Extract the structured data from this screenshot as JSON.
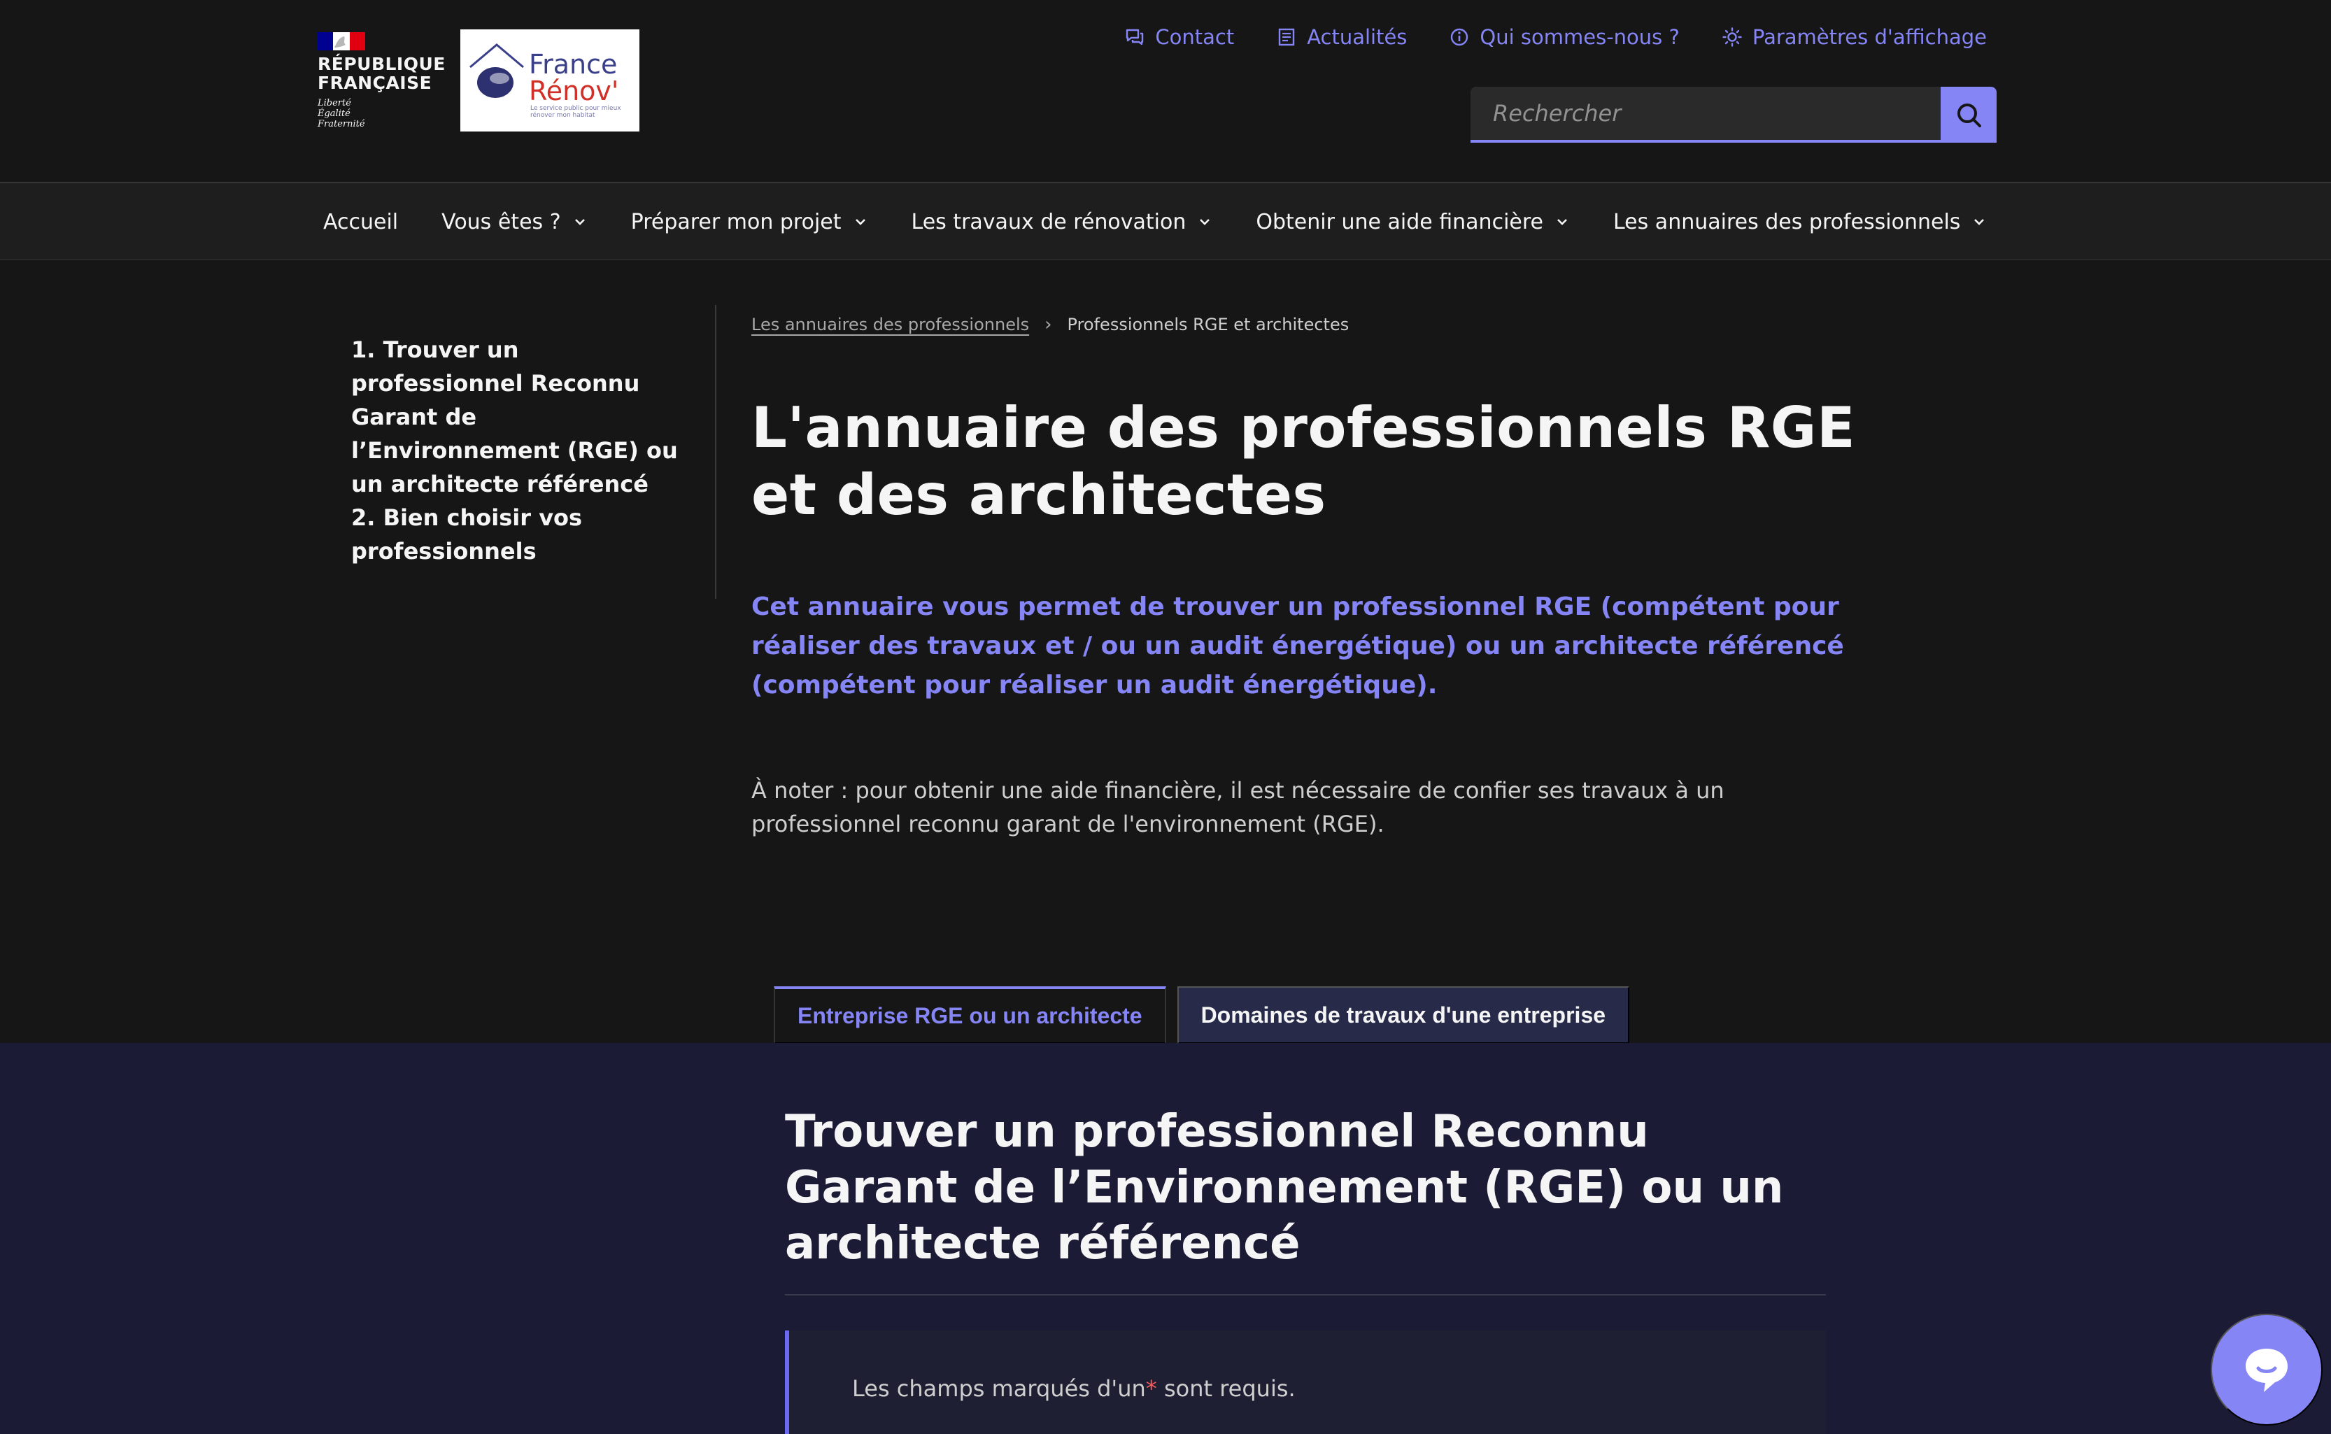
{
  "header": {
    "marianne": {
      "republic": "RÉPUBLIQUE\nFRANÇAISE",
      "motto": "Liberté\nÉgalité\nFraternité"
    },
    "operator": {
      "line1": "France",
      "line2": "Rénov'",
      "tagline": "Le service public pour mieux rénover mon habitat"
    },
    "quick_access": [
      {
        "label": "Contact",
        "icon": "chat-icon"
      },
      {
        "label": "Actualités",
        "icon": "newspaper-icon"
      },
      {
        "label": "Qui sommes-nous ?",
        "icon": "info-icon"
      },
      {
        "label": "Paramètres d'affichage",
        "icon": "sun-icon"
      }
    ],
    "search": {
      "placeholder": "Rechercher",
      "icon": "search-icon"
    }
  },
  "nav": {
    "items": [
      {
        "label": "Accueil",
        "has_dropdown": false
      },
      {
        "label": "Vous êtes ?",
        "has_dropdown": true
      },
      {
        "label": "Préparer mon projet",
        "has_dropdown": true
      },
      {
        "label": "Les travaux de rénovation",
        "has_dropdown": true
      },
      {
        "label": "Obtenir une aide financière",
        "has_dropdown": true
      },
      {
        "label": "Les annuaires des professionnels",
        "has_dropdown": true
      }
    ]
  },
  "sidemenu": {
    "items": [
      {
        "label": "1. Trouver un professionnel Reconnu Garant de l’Environnement (RGE) ou un architecte référencé"
      },
      {
        "label": "2. Bien choisir vos professionnels"
      }
    ]
  },
  "breadcrumb": {
    "items": [
      {
        "label": "Les annuaires des professionnels"
      },
      {
        "label": "Professionnels RGE et architectes"
      }
    ],
    "separator": "›"
  },
  "content": {
    "title": "L'annuaire des professionnels RGE et des architectes",
    "lead": "Cet annuaire vous permet de trouver un professionnel RGE (compétent pour réaliser des travaux et / ou un audit énergétique) ou un architecte référencé (compétent pour réaliser un audit énergétique).",
    "note": "À noter : pour obtenir une aide financière, il est nécessaire de confier ses travaux à un professionnel reconnu garant de l'environnement (RGE)."
  },
  "tabs": {
    "items": [
      {
        "label": "Entreprise RGE ou un architecte",
        "selected": true
      },
      {
        "label": "Domaines de travaux d'une entreprise",
        "selected": false
      }
    ]
  },
  "panel": {
    "title": "Trouver un professionnel Reconnu Garant de l’Environnement (RGE) ou un architecte référencé",
    "required_before": "Les champs marqués d'un",
    "required_star": "*",
    "required_after": "sont requis."
  },
  "chat": {
    "icon": "chat-bubble-icon"
  },
  "colors": {
    "background": "#161616",
    "accent": "#8585f6",
    "panel": "#1c1b36",
    "required": "#f95c5e"
  }
}
